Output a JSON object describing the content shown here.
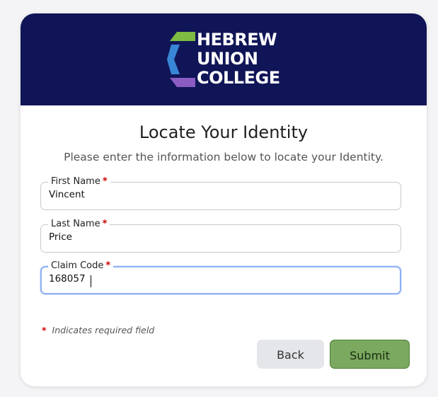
{
  "brand": {
    "logo_lines": [
      "HEBREW",
      "UNION",
      "COLLEGE"
    ],
    "header_color": "#101557",
    "logo_colors": {
      "green": "#7dbb42",
      "blue": "#3a86d6",
      "purple": "#8a5cc4"
    }
  },
  "form": {
    "title": "Locate Your Identity",
    "subtitle": "Please enter the information below to locate your Identity.",
    "fields": [
      {
        "label": "First Name",
        "value": "Vincent",
        "required": "*"
      },
      {
        "label": "Last Name",
        "value": "Price",
        "required": "*"
      },
      {
        "label": "Claim Code",
        "value": "168057",
        "required": "*"
      }
    ],
    "required_note_star": "*",
    "required_note": "Indicates required field",
    "back_label": "Back",
    "submit_label": "Submit"
  }
}
